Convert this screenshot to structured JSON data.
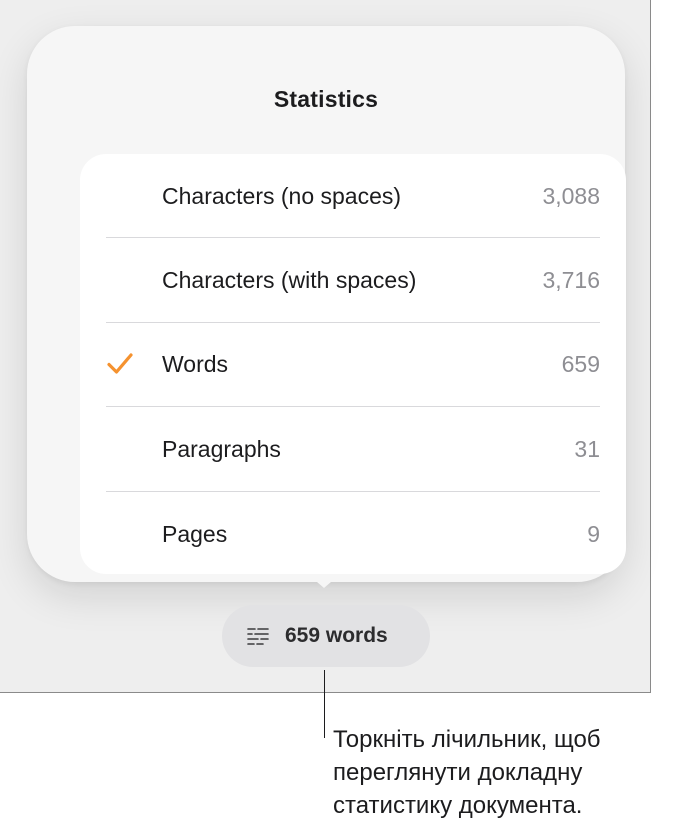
{
  "popover": {
    "title": "Statistics",
    "rows": [
      {
        "label": "Characters (no spaces)",
        "value": "3,088",
        "checked": false
      },
      {
        "label": "Characters (with spaces)",
        "value": "3,716",
        "checked": false
      },
      {
        "label": "Words",
        "value": "659",
        "checked": true
      },
      {
        "label": "Paragraphs",
        "value": "31",
        "checked": false
      },
      {
        "label": "Pages",
        "value": "9",
        "checked": false
      }
    ]
  },
  "counter": {
    "label": "659 words",
    "icon": "word-count-icon"
  },
  "callout": {
    "lines": [
      "Торкніть лічильник, щоб",
      "переглянути докладну",
      "статистику документа."
    ]
  },
  "colors": {
    "accent_check": "#f5922f",
    "value_gray": "#8e8e93",
    "card_bg": "#ffffff",
    "popover_bg": "#f6f6f6",
    "screen_bg": "#eeeeee"
  }
}
